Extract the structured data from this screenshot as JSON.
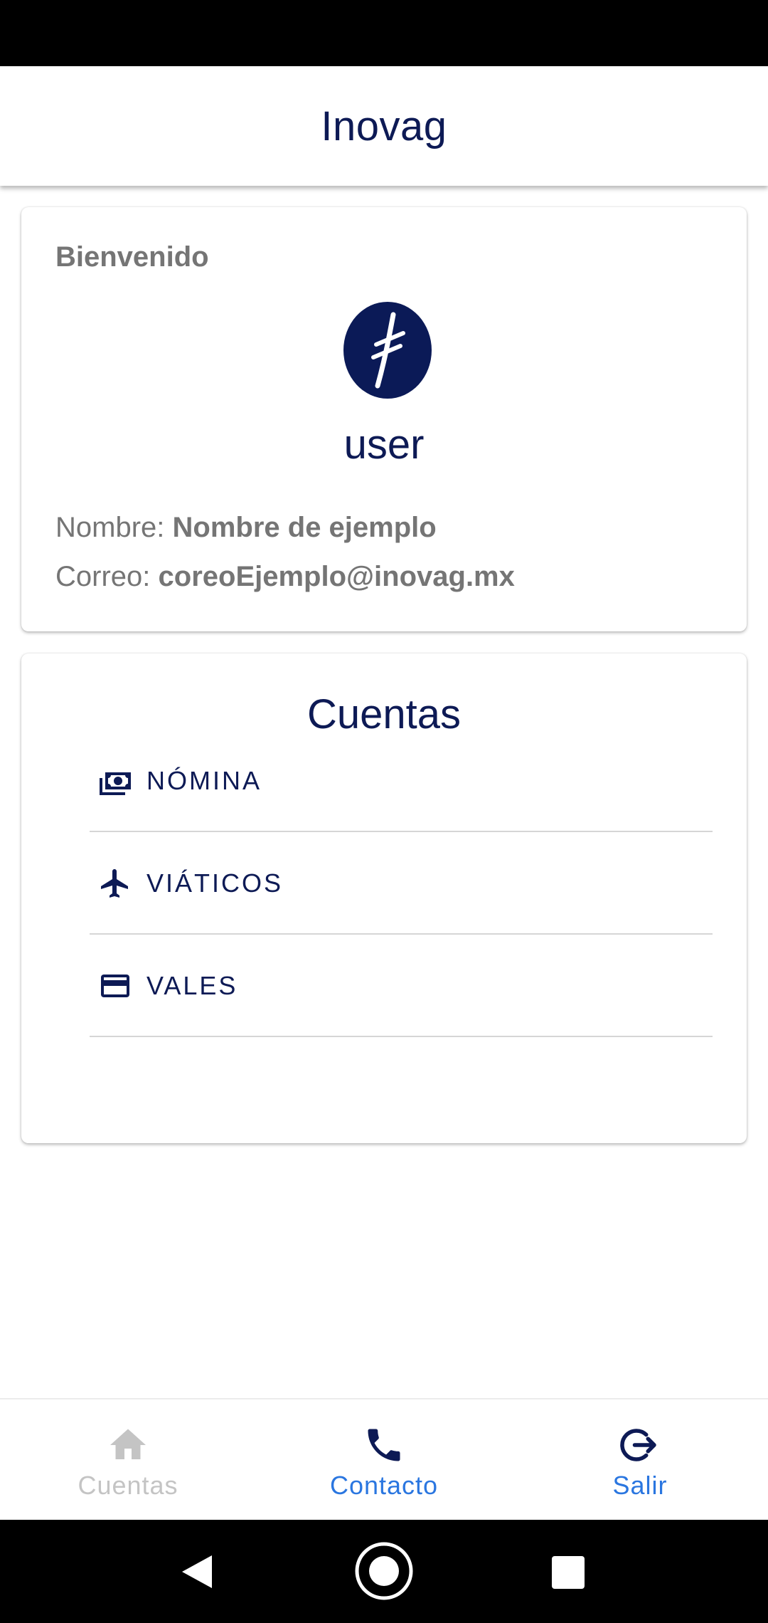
{
  "app": {
    "title": "Inovag"
  },
  "profile": {
    "welcome": "Bienvenido",
    "username": "user",
    "name_label": "Nombre:",
    "name_value": "Nombre de ejemplo",
    "email_label": "Correo:",
    "email_value": "coreoEjemplo@inovag.mx"
  },
  "accounts": {
    "title": "Cuentas",
    "items": [
      {
        "label": "NÓMINA",
        "icon": "money-icon"
      },
      {
        "label": "VIÁTICOS",
        "icon": "airplane-icon"
      },
      {
        "label": "VALES",
        "icon": "credit-card-icon"
      }
    ]
  },
  "bottom_nav": {
    "items": [
      {
        "label": "Cuentas",
        "icon": "home-icon",
        "state": "disabled"
      },
      {
        "label": "Contacto",
        "icon": "phone-icon",
        "state": "active"
      },
      {
        "label": "Salir",
        "icon": "logout-icon",
        "state": "active"
      }
    ]
  },
  "colors": {
    "primary": "#0d1a55",
    "accent": "#2a76e0",
    "muted": "#757575",
    "disabled": "#c4c4c4"
  }
}
